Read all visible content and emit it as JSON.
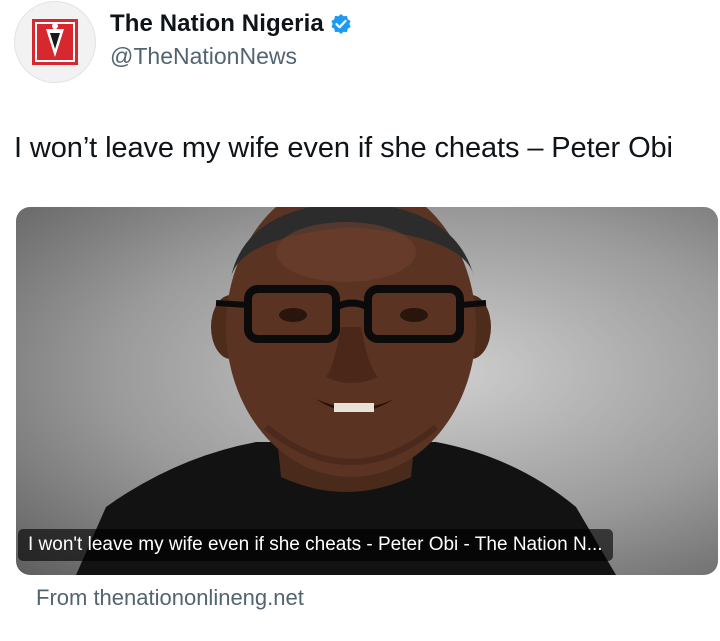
{
  "author": {
    "display_name": "The Nation Nigeria",
    "handle": "@TheNationNews",
    "avatar_icon": "the-nation-logo",
    "verified_icon": "verified-badge-icon",
    "verified_color": "#1d9bf0",
    "logo_red": "#d7282f"
  },
  "tweet": {
    "text": "I won’t leave my wife even if she cheats – Peter Obi"
  },
  "link_card": {
    "image_icon": "peter-obi-portrait",
    "title": "I won't leave my wife even if she cheats - Peter Obi - The Nation N...",
    "source": "From thenationonlineng.net"
  }
}
